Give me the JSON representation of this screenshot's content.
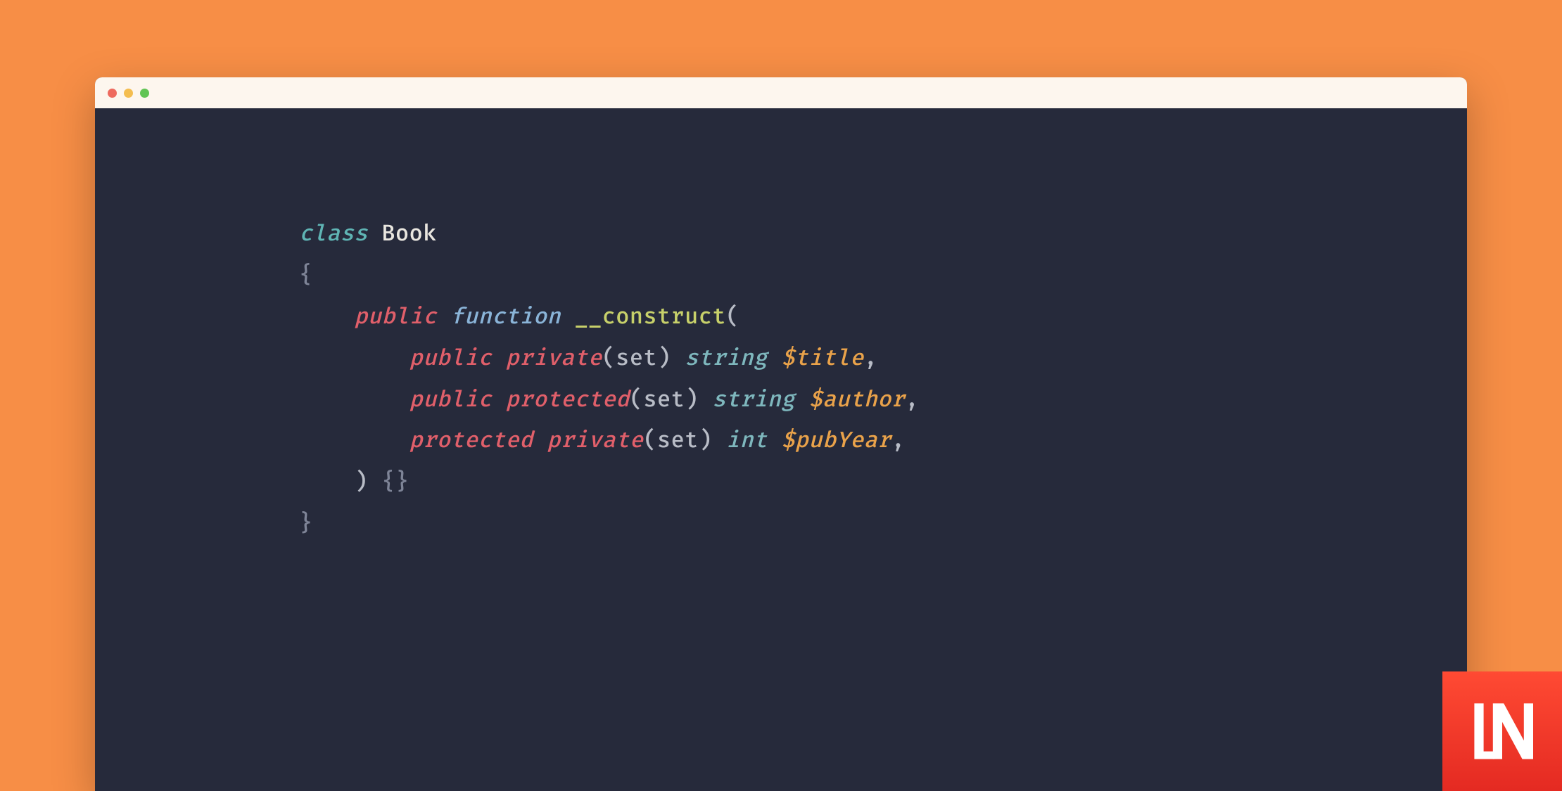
{
  "colors": {
    "background": "#f78e46",
    "editor_bg": "#262a3b",
    "titlebar_bg": "#fdf6ee",
    "dot_red": "#ee6a5e",
    "dot_yellow": "#f4bd4f",
    "dot_green": "#61c454",
    "logo_bg_top": "#ff4a33",
    "logo_bg_bottom": "#e42a22",
    "token_keyword_teal": "#5fb4b4",
    "token_classname": "#e9e6df",
    "token_brace": "#7e8497",
    "token_modifier": "#e05f6a",
    "token_function_kw": "#8ab4d8",
    "token_construct": "#c7d06a",
    "token_paren": "#b8bcc6",
    "token_type": "#7eb7bd",
    "token_variable": "#e9a24a"
  },
  "code": {
    "line1": {
      "class_kw": "class",
      "class_name": "Book"
    },
    "line2": {
      "brace_open": "{"
    },
    "line3": {
      "mod": "public",
      "fn_kw": "function",
      "dunder": "__",
      "construct": "construct",
      "paren_open": "("
    },
    "line4": {
      "mod1": "public",
      "mod2": "private",
      "paren_open": "(",
      "set": "set",
      "paren_close": ")",
      "type": "string",
      "var": "$title",
      "comma": ","
    },
    "line5": {
      "mod1": "public",
      "mod2": "protected",
      "paren_open": "(",
      "set": "set",
      "paren_close": ")",
      "type": "string",
      "var": "$author",
      "comma": ","
    },
    "line6": {
      "mod1": "protected",
      "mod2": "private",
      "paren_open": "(",
      "set": "set",
      "paren_close": ")",
      "type": "int",
      "var": "$pubYear",
      "comma": ","
    },
    "line7": {
      "paren_close": ")",
      "body": "{}"
    },
    "line8": {
      "brace_close": "}"
    }
  },
  "logo": {
    "text": "LN"
  }
}
